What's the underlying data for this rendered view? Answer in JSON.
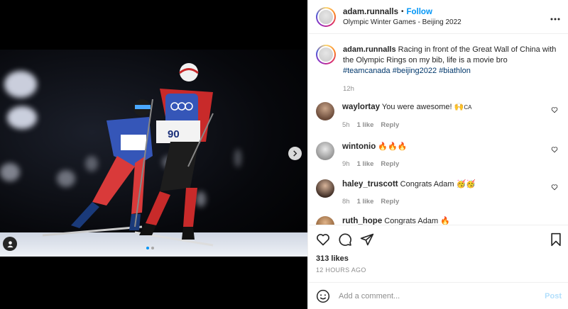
{
  "colors": {
    "link_blue": "#0095f6",
    "hashtag": "#00376b",
    "muted": "#8e8e8e",
    "post_disabled": "#b2dffc"
  },
  "header": {
    "username": "adam.runnalls",
    "separator": "•",
    "follow_label": "Follow",
    "location": "Olympic Winter Games - Beijing 2022",
    "more_icon": "more-horizontal-icon"
  },
  "media": {
    "next_icon": "chevron-right-icon",
    "tag_icon": "user-tag-icon",
    "carousel_count": 2,
    "carousel_active": 0
  },
  "caption": {
    "username": "adam.runnalls",
    "text": "Racing in front of the Great Wall of China with the Olympic Rings on my bib, life is a movie bro",
    "hashtags": [
      "#teamcanada",
      "#beijing2022",
      "#biathlon"
    ],
    "time": "12h"
  },
  "comments": [
    {
      "username": "waylortay",
      "text": "You were awesome! 🙌",
      "flag": "CA",
      "time": "5h",
      "likes": "1 like",
      "reply": "Reply"
    },
    {
      "username": "wintonio",
      "text": "🔥🔥🔥",
      "time": "9h",
      "likes": "1 like",
      "reply": "Reply"
    },
    {
      "username": "haley_truscott",
      "text": "Congrats Adam 🥳🥳",
      "time": "8h",
      "likes": "1 like",
      "reply": "Reply"
    },
    {
      "username": "ruth_hope",
      "text": "Congrats Adam 🔥",
      "time": "",
      "likes": "",
      "reply": ""
    }
  ],
  "actions": {
    "like_icon": "heart-icon",
    "comment_icon": "comment-icon",
    "share_icon": "send-icon",
    "save_icon": "bookmark-icon"
  },
  "likes": "313 likes",
  "time_ago": "12 HOURS AGO",
  "add_comment": {
    "emoji_icon": "emoji-icon",
    "placeholder": "Add a comment...",
    "post_label": "Post"
  }
}
